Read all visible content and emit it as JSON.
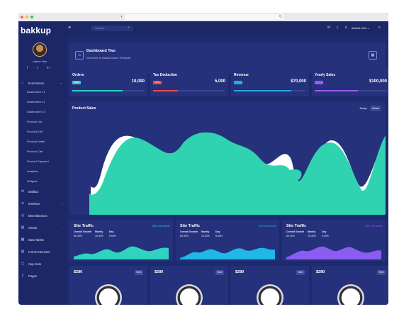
{
  "browser": {
    "url": ""
  },
  "brand": {
    "name": "bakkup"
  },
  "user": {
    "name": "Lakion Deo"
  },
  "topbar": {
    "search_placeholder": "Search...",
    "user_name": "Adnesh Oru"
  },
  "sidebar": {
    "items": [
      {
        "label": "Ecommerce",
        "icon": "cart-icon",
        "expanded": true
      },
      {
        "label": "Mailbox",
        "icon": "mail-icon"
      },
      {
        "label": "Interface",
        "icon": "wifi-icon"
      },
      {
        "label": "Miscellaneous",
        "icon": "layers-icon"
      },
      {
        "label": "Charts",
        "icon": "chart-icon"
      },
      {
        "label": "Data Tables",
        "icon": "table-icon"
      },
      {
        "label": "Forms Elements",
        "icon": "form-icon"
      },
      {
        "label": "App-more",
        "icon": "app-icon"
      },
      {
        "label": "Pages",
        "icon": "pages-icon"
      }
    ],
    "sub_items": [
      "Dashboard v.1",
      "Dashboard v.2",
      "Dashboard v.3",
      "Product List",
      "Product Edit",
      "Product Detail",
      "Product Cart",
      "Product Payment",
      "Analytics",
      "Widgets"
    ]
  },
  "dashboard": {
    "title": "Dashboard Two",
    "subtitle": "Welcome to Nalika Admin Template"
  },
  "stats": [
    {
      "title": "Orders",
      "badge": "80%",
      "value": "10,000",
      "color": "#2fd3c0",
      "fill": 0.7
    },
    {
      "title": "Tax Deduction",
      "badge": "75%",
      "value": "5,000",
      "color": "#f04a4a",
      "fill": 0.35
    },
    {
      "title": "Revenue",
      "badge": "",
      "value": "$70,000",
      "color": "#2aa9e6",
      "fill": 0.8
    },
    {
      "title": "Yearly Sales",
      "badge": "",
      "value": "$100,000",
      "color": "#9a5cf0",
      "fill": 0.6
    }
  ],
  "sales": {
    "title": "Product Sales",
    "pill_today": "Today",
    "pill_week": "Week"
  },
  "traffic": [
    {
      "title": "Site Traffic",
      "change": "30% Last Month",
      "labels": [
        "Overall Growth",
        "Montly",
        "Day"
      ],
      "values": [
        "80.40%",
        "15.40%",
        "5.50%"
      ],
      "color": "#2fd3c0"
    },
    {
      "title": "Site Traffic",
      "change": "30% Last Month",
      "labels": [
        "Overall Growth",
        "Montly",
        "Day"
      ],
      "values": [
        "80.40%",
        "15.40%",
        "5.50%"
      ],
      "color": "#22b8e6"
    },
    {
      "title": "Site Traffic",
      "change": "30% Last Month",
      "labels": [
        "Overall Growth",
        "Montly",
        "Day"
      ],
      "values": [
        "80.40%",
        "15.40%",
        "5.50%"
      ],
      "color": "#8a5cf0"
    }
  ],
  "products": [
    {
      "price": "$280",
      "tag": "New"
    },
    {
      "price": "$280",
      "tag": "New"
    },
    {
      "price": "$280",
      "tag": "New"
    },
    {
      "price": "$280",
      "tag": "New"
    }
  ]
}
